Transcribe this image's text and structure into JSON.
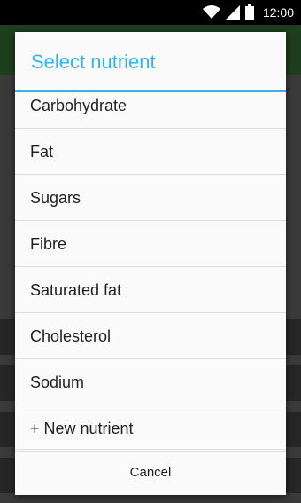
{
  "status_bar": {
    "time": "12:00",
    "icons": [
      "wifi-icon",
      "signal-icon",
      "battery-icon"
    ]
  },
  "dialog": {
    "title": "Select nutrient",
    "items": [
      "Carbohydrate",
      "Fat",
      "Sugars",
      "Fibre",
      "Saturated fat",
      "Cholesterol",
      "Sodium",
      "+ New nutrient"
    ],
    "cancel_label": "Cancel"
  },
  "colors": {
    "accent": "#33b5e5",
    "app_bar": "#1d3f1e",
    "status_bar": "#000000"
  }
}
